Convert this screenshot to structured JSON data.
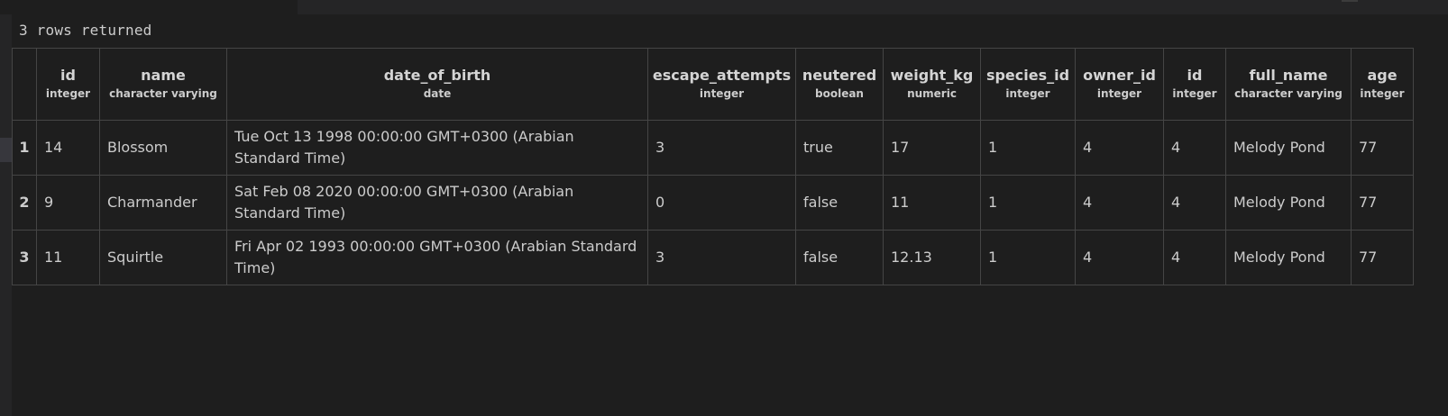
{
  "status_text": "3 rows returned",
  "columns": [
    {
      "name": "id",
      "type": "integer"
    },
    {
      "name": "name",
      "type": "character varying"
    },
    {
      "name": "date_of_birth",
      "type": "date"
    },
    {
      "name": "escape_attempts",
      "type": "integer"
    },
    {
      "name": "neutered",
      "type": "boolean"
    },
    {
      "name": "weight_kg",
      "type": "numeric"
    },
    {
      "name": "species_id",
      "type": "integer"
    },
    {
      "name": "owner_id",
      "type": "integer"
    },
    {
      "name": "id",
      "type": "integer"
    },
    {
      "name": "full_name",
      "type": "character varying"
    },
    {
      "name": "age",
      "type": "integer"
    }
  ],
  "rows": [
    {
      "row_number": "1",
      "cells": [
        "14",
        "Blossom",
        "Tue Oct 13 1998 00:00:00 GMT+0300 (Arabian Standard Time)",
        "3",
        "true",
        "17",
        "1",
        "4",
        "4",
        "Melody Pond",
        "77"
      ]
    },
    {
      "row_number": "2",
      "cells": [
        "9",
        "Charmander",
        "Sat Feb 08 2020 00:00:00 GMT+0300 (Arabian Standard Time)",
        "0",
        "false",
        "11",
        "1",
        "4",
        "4",
        "Melody Pond",
        "77"
      ]
    },
    {
      "row_number": "3",
      "cells": [
        "11",
        "Squirtle",
        "Fri Apr 02 1993 00:00:00 GMT+0300 (Arabian Standard Time)",
        "3",
        "false",
        "12.13",
        "1",
        "4",
        "4",
        "Melody Pond",
        "77"
      ]
    }
  ],
  "colors": {
    "background": "#1e1e1e",
    "grid": "#454545",
    "text": "#cccccc"
  }
}
